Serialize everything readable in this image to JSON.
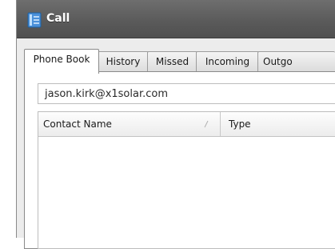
{
  "window": {
    "title": "Call"
  },
  "tabs": [
    {
      "label": "Phone Book",
      "active": true
    },
    {
      "label": "History",
      "active": false
    },
    {
      "label": "Missed",
      "active": false
    },
    {
      "label": "Incoming",
      "active": false
    },
    {
      "label": "Outgo",
      "active": false
    }
  ],
  "search": {
    "value": "jason.kirk@x1solar.com"
  },
  "table": {
    "columns": [
      "Contact Name",
      "Type"
    ],
    "sort_column": "Contact Name",
    "rows": []
  },
  "colors": {
    "titlebar": "#5b5b5b",
    "window_bg": "#ececec",
    "title_icon": "#4a90d9"
  },
  "icons": {
    "title": "address-book-icon",
    "sort": "sort-indicator-icon"
  }
}
